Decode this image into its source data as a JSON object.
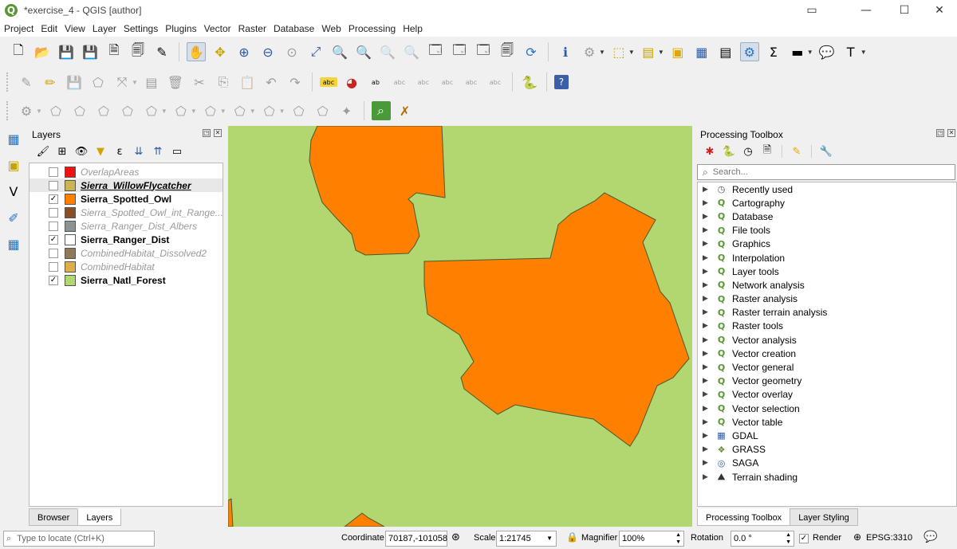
{
  "window": {
    "title": "*exercise_4 - QGIS [author]",
    "logo_letter": "Q"
  },
  "menu": [
    "Project",
    "Edit",
    "View",
    "Layer",
    "Settings",
    "Plugins",
    "Vector",
    "Raster",
    "Database",
    "Web",
    "Processing",
    "Help"
  ],
  "layers_panel": {
    "title": "Layers",
    "layers": [
      {
        "name": "OverlapAreas",
        "checked": false,
        "color": "#ee1111",
        "state": "off"
      },
      {
        "name": "Sierra_WillowFlycatcher",
        "checked": false,
        "color": "#c9b653",
        "state": "sel"
      },
      {
        "name": "Sierra_Spotted_Owl",
        "checked": true,
        "color": "#ff7f00",
        "state": "on"
      },
      {
        "name": "Sierra_Spotted_Owl_int_Range...",
        "checked": false,
        "color": "#8b4f27",
        "state": "off"
      },
      {
        "name": "Sierra_Ranger_Dist_Albers",
        "checked": false,
        "color": "#8a9492",
        "state": "off"
      },
      {
        "name": "Sierra_Ranger_Dist",
        "checked": true,
        "color": "#ffffff",
        "state": "on"
      },
      {
        "name": "CombinedHabitat_Dissolved2",
        "checked": false,
        "color": "#8f7858",
        "state": "off"
      },
      {
        "name": "CombinedHabitat",
        "checked": false,
        "color": "#ddb04a",
        "state": "off"
      },
      {
        "name": "Sierra_Natl_Forest",
        "checked": true,
        "color": "#b2d670",
        "state": "on"
      }
    ],
    "tabs": [
      "Browser",
      "Layers"
    ]
  },
  "processing": {
    "title": "Processing Toolbox",
    "search_placeholder": "Search...",
    "items": [
      {
        "label": "Recently used",
        "icon": "clock-icon"
      },
      {
        "label": "Cartography",
        "icon": "qgis-q-icon"
      },
      {
        "label": "Database",
        "icon": "qgis-q-icon"
      },
      {
        "label": "File tools",
        "icon": "qgis-q-icon"
      },
      {
        "label": "Graphics",
        "icon": "qgis-q-icon"
      },
      {
        "label": "Interpolation",
        "icon": "qgis-q-icon"
      },
      {
        "label": "Layer tools",
        "icon": "qgis-q-icon"
      },
      {
        "label": "Network analysis",
        "icon": "qgis-q-icon"
      },
      {
        "label": "Raster analysis",
        "icon": "qgis-q-icon"
      },
      {
        "label": "Raster terrain analysis",
        "icon": "qgis-q-icon"
      },
      {
        "label": "Raster tools",
        "icon": "qgis-q-icon"
      },
      {
        "label": "Vector analysis",
        "icon": "qgis-q-icon"
      },
      {
        "label": "Vector creation",
        "icon": "qgis-q-icon"
      },
      {
        "label": "Vector general",
        "icon": "qgis-q-icon"
      },
      {
        "label": "Vector geometry",
        "icon": "qgis-q-icon"
      },
      {
        "label": "Vector overlay",
        "icon": "qgis-q-icon"
      },
      {
        "label": "Vector selection",
        "icon": "qgis-q-icon"
      },
      {
        "label": "Vector table",
        "icon": "qgis-q-icon"
      },
      {
        "label": "GDAL",
        "icon": "gdal-icon"
      },
      {
        "label": "GRASS",
        "icon": "grass-icon"
      },
      {
        "label": "SAGA",
        "icon": "saga-icon"
      },
      {
        "label": "Terrain shading",
        "icon": "terrain-icon"
      }
    ],
    "tabs": [
      "Processing Toolbox",
      "Layer Styling"
    ]
  },
  "statusbar": {
    "locate_placeholder": "Type to locate (Ctrl+K)",
    "coordinate_label": "Coordinate",
    "coordinate_value": "70187,-101058",
    "scale_label": "Scale",
    "scale_value": "1:21745",
    "magnifier_label": "Magnifier",
    "magnifier_value": "100%",
    "rotation_label": "Rotation",
    "rotation_value": "0.0 °",
    "render_label": "Render",
    "crs": "EPSG:3310"
  },
  "map_colors": {
    "forest": "#b2d670",
    "owl": "#ff7f00"
  }
}
